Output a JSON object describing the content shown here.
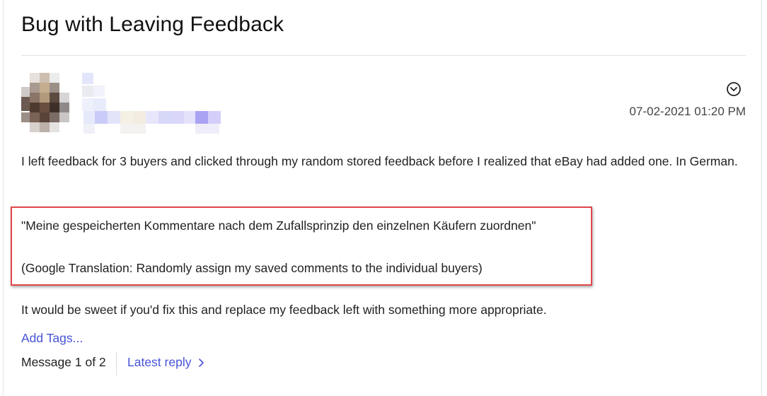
{
  "post": {
    "title": "Bug with Leaving Feedback",
    "timestamp": "07-02-2021 01:20 PM",
    "paragraph1": "I left feedback for 3 buyers and clicked through my random stored feedback before I realized that eBay had added one. In German.",
    "quote_german": "\"Meine gespeicherten Kommentare nach dem Zufallsprinzip den einzelnen Käufern zuordnen\"",
    "quote_translation": "(Google Translation: Randomly assign my saved comments to the individual buyers)",
    "paragraph3": "It would be sweet if you'd fix this and replace my feedback left with something more appropriate."
  },
  "actions": {
    "add_tags": "Add Tags...",
    "message_count": "Message 1 of 2",
    "latest_reply": "Latest reply"
  },
  "icons": {
    "options": "chevron-down-circle-icon",
    "latest_reply_arrow": "chevron-right-icon"
  },
  "colors": {
    "link": "#4754d6",
    "highlight_border": "#e0474c"
  }
}
